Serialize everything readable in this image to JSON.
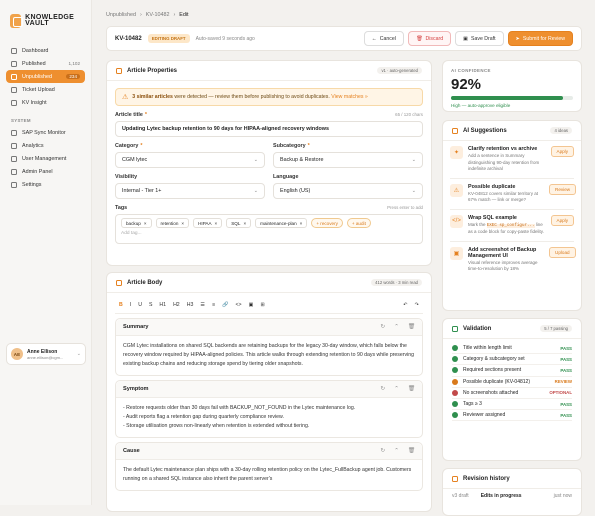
{
  "sidebar": {
    "logo": "KNOWLEDGE VAULT",
    "items": [
      {
        "label": "Dashboard",
        "count": ""
      },
      {
        "label": "Published",
        "count": "1,102"
      },
      {
        "label": "Unpublished",
        "count": "234"
      },
      {
        "label": "Ticket Upload",
        "count": ""
      },
      {
        "label": "KV Insight",
        "count": ""
      }
    ],
    "system_label": "SYSTEM",
    "system_items": [
      {
        "label": "SAP Sync Monitor"
      },
      {
        "label": "Analytics"
      },
      {
        "label": "User Management"
      },
      {
        "label": "Admin Panel"
      },
      {
        "label": "Settings"
      }
    ],
    "user": {
      "initials": "AE",
      "name": "Anne Ellison",
      "email": "anne.ellison@cgm..."
    }
  },
  "breadcrumb": {
    "a": "Unpublished",
    "b": "KV-10482",
    "c": "Edit",
    "sep": "›"
  },
  "topbar": {
    "id": "KV-10482",
    "badge": "EDITING DRAFT",
    "saved": "Auto-saved 9 seconds ago",
    "cancel": "Cancel",
    "discard": "Discard",
    "save": "Save Draft",
    "submit": "Submit for Review"
  },
  "props": {
    "title": "Article Properties",
    "version": "v1 · auto-generated",
    "warn_bold": "3 similar articles",
    "warn_text": " were detected — review them before publishing to avoid duplicates.",
    "warn_link": "View matches »",
    "article_title_label": "Article title",
    "title_count": "65 / 120 chars",
    "article_title": "Updating Lytec backup retention to 90 days for HIPAA-aligned recovery windows",
    "category_label": "Category",
    "category": "CGM lytec",
    "subcategory_label": "Subcategory",
    "subcategory": "Backup & Restore",
    "visibility_label": "Visibility",
    "visibility": "Internal - Tier 1+",
    "language_label": "Language",
    "language": "English (US)",
    "tags_label": "Tags",
    "tags_hint": "Press enter to add",
    "tags": [
      "backup",
      "retention",
      "HIPAA",
      "SQL",
      "maintenance-plan"
    ],
    "suggested": [
      "+ recovery",
      "+ audit"
    ],
    "tag_placeholder": "Add tag..."
  },
  "body": {
    "title": "Article Body",
    "meta": "412 words · 3 min read",
    "toolbar": [
      "B",
      "I",
      "U",
      "S",
      "H1",
      "H2",
      "H3",
      "☰",
      "≡",
      "🔗",
      "<>",
      "▣",
      "⊞",
      "↶",
      "↷"
    ],
    "sections": [
      {
        "name": "Summary",
        "text": "CGM Lytec installations on shared SQL backends are retaining backups for the legacy 30-day window, which falls below the recovery window required by HIPAA-aligned policies. This article walks through extending retention to 90 days while preserving existing backup chains and reducing storage spend by tiering older snapshots."
      },
      {
        "name": "Symptom",
        "lines": [
          "- Restore requests older than 30 days fail with BACKUP_NOT_FOUND in the Lytec maintenance log.",
          "- Audit reports flag a retention gap during quarterly compliance review.",
          "- Storage utilisation grows non-linearly when retention is extended without tiering."
        ]
      },
      {
        "name": "Cause",
        "text": "The default Lytec maintenance plan ships with a 30-day rolling retention policy on the Lytec_FullBackup agent job. Customers running on a shared SQL instance also inherit the parent server's"
      }
    ]
  },
  "confidence": {
    "label": "AI CONFIDENCE",
    "value": "92%",
    "fraction": 0.92,
    "caption": "High — auto-approve eligible"
  },
  "suggestions": {
    "title": "AI Suggestions",
    "count": "4 ideas",
    "items": [
      {
        "title": "Clarify retention vs archive",
        "text": "Add a sentence in Summary distinguishing 90-day retention from indefinite archival",
        "action": "Apply"
      },
      {
        "title": "Possible duplicate",
        "text": "KV-04812 covers similar territory at 67% match — link or merge?",
        "action": "Review"
      },
      {
        "title": "Wrap SQL example",
        "pre": "Mark the ",
        "code": "EXEC sp_configur...",
        "post": " line as a code block for copy-paste fidelity.",
        "action": "Apply"
      },
      {
        "title": "Add screenshot of Backup Management UI",
        "text": "Visual reference improves average time-to-resolution by 18%",
        "action": "Upload"
      }
    ]
  },
  "validation": {
    "title": "Validation",
    "count": "5 / 7 passing",
    "rows": [
      {
        "label": "Title within length limit",
        "status": "PASS",
        "color": "#2f8f4e"
      },
      {
        "label": "Category & subcategory set",
        "status": "PASS",
        "color": "#2f8f4e"
      },
      {
        "label": "Required sections present",
        "status": "PASS",
        "color": "#2f8f4e"
      },
      {
        "label": "Possible duplicate (KV-04812)",
        "status": "REVIEW",
        "color": "#d97a1c"
      },
      {
        "label": "No screenshots attached",
        "status": "OPTIONAL",
        "color": "#c24a4a"
      },
      {
        "label": "Tags ≥ 3",
        "status": "PASS",
        "color": "#2f8f4e"
      },
      {
        "label": "Reviewer assigned",
        "status": "PASS",
        "color": "#2f8f4e"
      }
    ]
  },
  "revision": {
    "title": "Revision history",
    "row": {
      "ver": "v3 draft",
      "label": "Edits in progress",
      "time": "just now"
    }
  }
}
